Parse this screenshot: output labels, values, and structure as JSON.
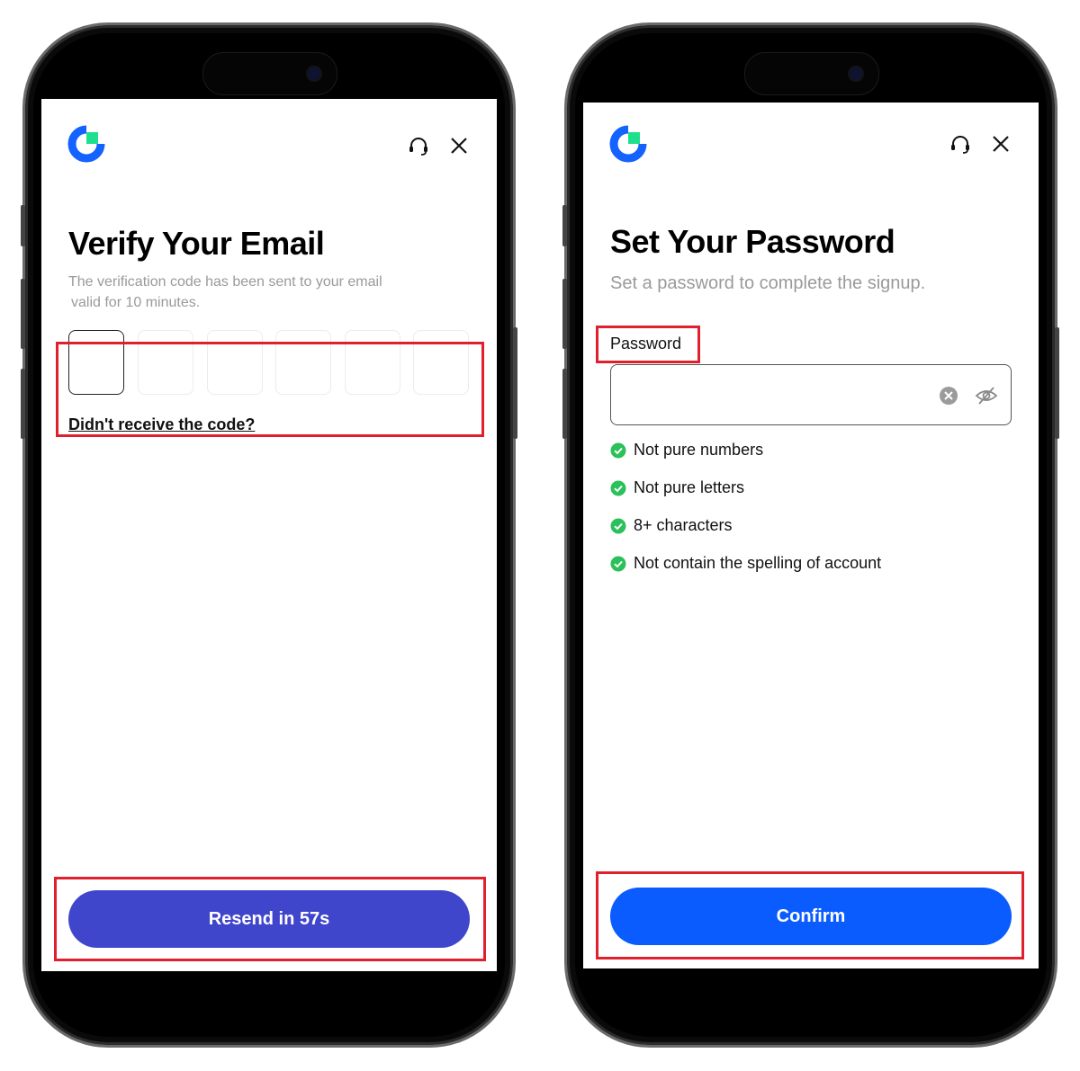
{
  "colors": {
    "logo_blue": "#1463ff",
    "logo_green": "#1ee08c",
    "resend_button": "#4046cc",
    "confirm_button": "#0a5cff",
    "check_green": "#2bc05a",
    "highlight_red": "#e0202c"
  },
  "verify_screen": {
    "title": "Verify Your Email",
    "subtitle_line1": "The verification code has been sent to your email",
    "subtitle_line2": "valid for 10 minutes.",
    "otp_digits": [
      "",
      "",
      "",
      "",
      "",
      ""
    ],
    "resend_link": "Didn't receive the code?",
    "resend_button": "Resend in 57s",
    "icons": [
      "logo-icon",
      "support-headset-icon",
      "close-icon"
    ]
  },
  "password_screen": {
    "title": "Set Your Password",
    "subtitle": "Set a password to complete the signup.",
    "password_label": "Password",
    "password_value": "",
    "rules": [
      {
        "text": "Not pure numbers",
        "met": true
      },
      {
        "text": "Not pure letters",
        "met": true
      },
      {
        "text": "8+ characters",
        "met": true
      },
      {
        "text": "Not contain the spelling of account",
        "met": true
      }
    ],
    "confirm_button": "Confirm",
    "icons": [
      "logo-icon",
      "support-headset-icon",
      "close-icon",
      "clear-input-icon",
      "hide-password-icon",
      "check-circle-icon"
    ]
  }
}
